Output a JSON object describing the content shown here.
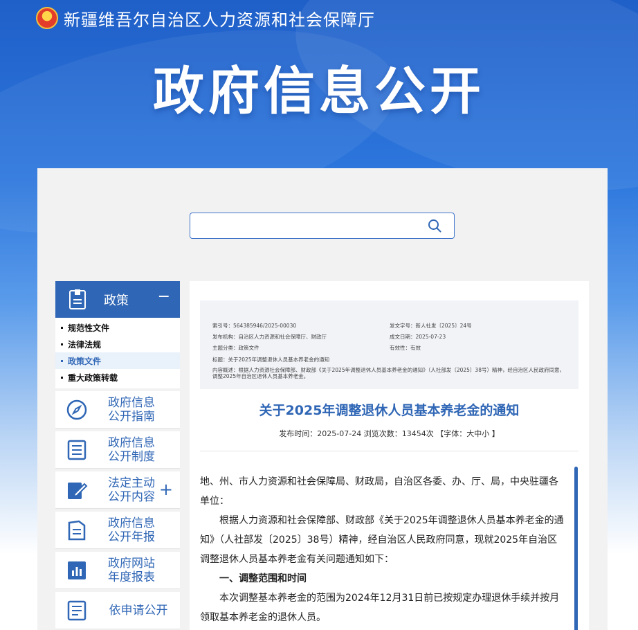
{
  "header": {
    "org_name": "新疆维吾尔自治区人力资源和社会保障厅",
    "banner_title": "政府信息公开"
  },
  "search": {
    "placeholder": ""
  },
  "sidebar": {
    "category": {
      "label": "政策",
      "toggle": "−"
    },
    "sub_items": [
      {
        "label": "规范性文件"
      },
      {
        "label": "法律法规"
      },
      {
        "label": "政策文件"
      },
      {
        "label": "重大政策转载"
      }
    ],
    "nav": [
      {
        "label": "政府信息公开指南",
        "icon": "compass-icon"
      },
      {
        "label": "政府信息公开制度",
        "icon": "list-icon"
      },
      {
        "label": "法定主动公开内容",
        "icon": "edit-icon",
        "expand": "+"
      },
      {
        "label": "政府信息公开年报",
        "icon": "book-icon"
      },
      {
        "label": "政府网站年度报表",
        "icon": "chart-icon"
      },
      {
        "label": "依申请公开",
        "icon": "document-icon"
      }
    ]
  },
  "meta": {
    "index_no": "索引号：564385946/2025-00030",
    "doc_no": "发文字号：新人社发〔2025〕24号",
    "issuer": "发布机构：自治区人力资源和社会保障厅、财政厅",
    "date_made": "成文日期：2025-07-23",
    "topic": "主题分类：政策文件",
    "validity": "有效性：有效",
    "title_line": "标题：关于2025年调整退休人员基本养老金的通知",
    "summary": "内容概述：根据人力资源社会保障部、财政部《关于2025年调整退休人员基本养老金的通知》（人社部发〔2025〕38号）精神，经自治区人民政府同意，调整2025年自治区退休人员基本养老金。"
  },
  "article": {
    "title": "关于2025年调整退休人员基本养老金的通知",
    "publish_line": "发布时间：2025-07-24   浏览次数：13454次   【字体：大中小 】",
    "paragraphs": [
      "地、州、市人力资源和社会保障局、财政局，自治区各委、办、厅、局，中央驻疆各单位：",
      "根据人力资源和社会保障部、财政部《关于2025年调整退休人员基本养老金的通知》（人社部发〔2025〕38号）精神，经自治区人民政府同意，现就2025年自治区调整退休人员基本养老金有关问题通知如下：",
      "一、调整范围和时间",
      "本次调整基本养老金的范围为2024年12月31日前已按规定办理退休手续并按月领取基本养老金的退休人员。"
    ]
  }
}
